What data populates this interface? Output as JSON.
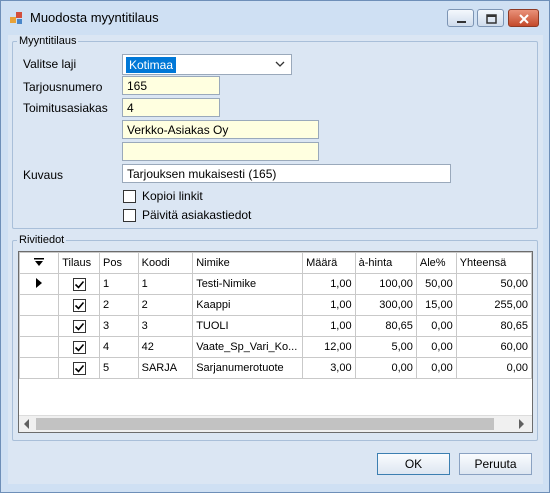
{
  "window": {
    "title": "Muodosta myyntitilaus"
  },
  "header": {
    "group_label": "Myyntitilaus",
    "type_label": "Valitse laji",
    "type_value": "Kotimaa",
    "quote_label": "Tarjousnumero",
    "quote_value": "165",
    "customer_label": "Toimitusasiakas",
    "customer_value": "4",
    "customer_name": "Verkko-Asiakas Oy",
    "customer_extra": "",
    "description_label": "Kuvaus",
    "description_value": "Tarjouksen mukaisesti (165)",
    "copy_links_label": "Kopioi linkit",
    "copy_links_checked": false,
    "update_customer_label": "Päivitä asiakastiedot",
    "update_customer_checked": false
  },
  "rows_section": {
    "group_label": "Rivitiedot",
    "columns": [
      "Tilaus",
      "Pos",
      "Koodi",
      "Nimike",
      "Määrä",
      "à-hinta",
      "Ale%",
      "Yhteensä"
    ],
    "rows": [
      {
        "current": true,
        "tilaus": true,
        "pos": "1",
        "koodi": "1",
        "nimike": "Testi-Nimike",
        "maara": "1,00",
        "hinta": "100,00",
        "ale": "50,00",
        "yhteensa": "50,00"
      },
      {
        "current": false,
        "tilaus": true,
        "pos": "2",
        "koodi": "2",
        "nimike": "Kaappi",
        "maara": "1,00",
        "hinta": "300,00",
        "ale": "15,00",
        "yhteensa": "255,00"
      },
      {
        "current": false,
        "tilaus": true,
        "pos": "3",
        "koodi": "3",
        "nimike": "TUOLI",
        "maara": "1,00",
        "hinta": "80,65",
        "ale": "0,00",
        "yhteensa": "80,65"
      },
      {
        "current": false,
        "tilaus": true,
        "pos": "4",
        "koodi": "42",
        "nimike": "Vaate_Sp_Vari_Ko...",
        "maara": "12,00",
        "hinta": "5,00",
        "ale": "0,00",
        "yhteensa": "60,00"
      },
      {
        "current": false,
        "tilaus": true,
        "pos": "5",
        "koodi": "SARJA",
        "nimike": "Sarjanumerotuote",
        "maara": "3,00",
        "hinta": "0,00",
        "ale": "0,00",
        "yhteensa": "0,00"
      }
    ]
  },
  "buttons": {
    "ok": "OK",
    "cancel": "Peruuta"
  },
  "colors": {
    "client_bg": "#dbe6f3",
    "input_bg": "#ffffe0",
    "selection": "#0078d7"
  }
}
